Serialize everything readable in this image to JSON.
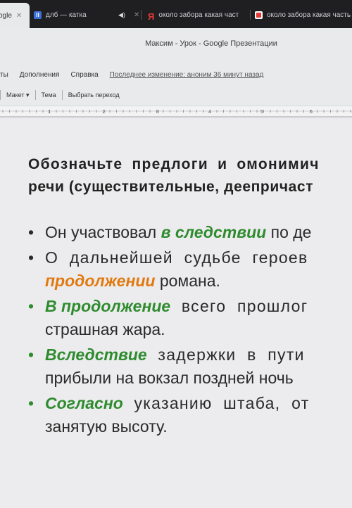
{
  "browser": {
    "tabs": [
      {
        "label": "ogle",
        "active": true
      },
      {
        "label": "длб — катка",
        "favicon": "II"
      },
      {
        "label": "около забора какая част"
      },
      {
        "label": "около забора какая часть"
      }
    ]
  },
  "doc": {
    "title": "Максим - Урок - Google Презентации",
    "menu": [
      "ты",
      "Дополнения",
      "Справка"
    ],
    "last_edit": "Последнее изменение: аноним 36 минут назад"
  },
  "toolbar": {
    "layout": "Макет ▾",
    "theme": "Тема",
    "transition": "Выбрать переход"
  },
  "ruler": {
    "numbers": [
      "1",
      "2",
      "3",
      "4",
      "5",
      "6"
    ]
  },
  "slide": {
    "heading_line1": "Обозначьте предлоги и омонимич",
    "heading_line2": "речи (существительные, деепричаст",
    "b1": {
      "pre": "Он участвовал ",
      "hl": "в следствии",
      "post": " по де"
    },
    "b2": {
      "line1": "О дальнейшей судьбе героев",
      "hl": "продолжении",
      "post": " романа."
    },
    "b3": {
      "hl": "В продолжение",
      "line1_post": " всего прошлог",
      "line2": "страшная жара."
    },
    "b4": {
      "hl": "Вследствие",
      "line1_post": " задержки в пути",
      "line2": "прибыли на вокзал поздней ночь"
    },
    "b5": {
      "hl": "Согласно",
      "line1_post": " указанию штаба, от",
      "line2": "занятую высоту."
    },
    "colors": {
      "green": "#2e8b2e",
      "orange": "#e07a10"
    }
  }
}
